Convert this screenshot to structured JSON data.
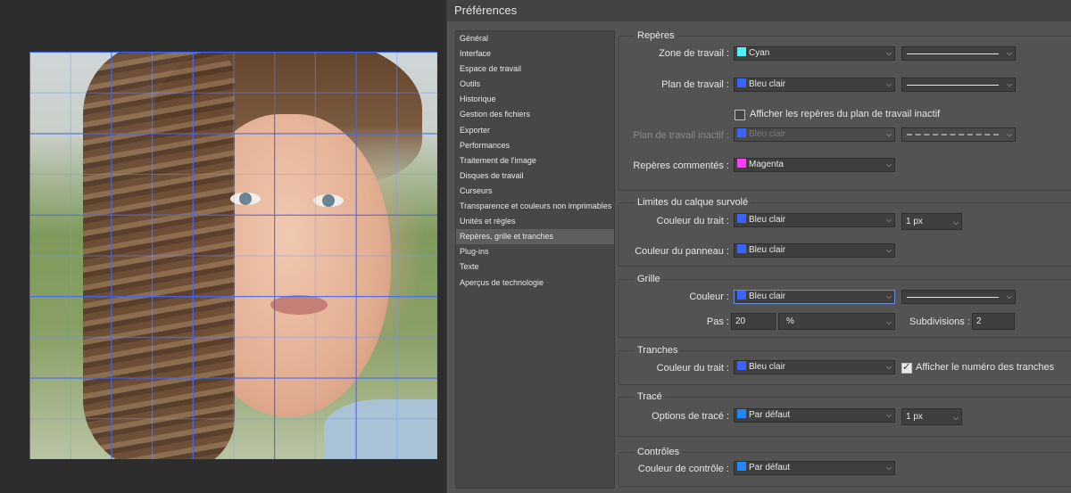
{
  "window": {
    "title": "Préférences"
  },
  "colors": {
    "cyan": "#4df3ff",
    "bleu_clair": "#3a64ff",
    "magenta": "#ff3dff",
    "par_defaut": "#1f86ff"
  },
  "nav": {
    "items": [
      "Général",
      "Interface",
      "Espace de travail",
      "Outils",
      "Historique",
      "Gestion des fichiers",
      "Exporter",
      "Performances",
      "Traitement de l'image",
      "Disques de travail",
      "Curseurs",
      "Transparence et couleurs non imprimables",
      "Unités et règles",
      "Repères, grille et tranches",
      "Plug-ins",
      "Texte",
      "Aperçus de technologie"
    ],
    "selected": "Repères, grille et tranches"
  },
  "reperes": {
    "title": "Repères",
    "zone_label": "Zone de travail :",
    "zone_value": "Cyan",
    "plan_label": "Plan de travail :",
    "plan_value": "Bleu clair",
    "inactive_check_label": "Afficher les repères du plan de travail inactif",
    "inactive_label": "Plan de travail inactif :",
    "inactive_value": "Bleu clair",
    "comment_label": "Repères commentés :",
    "comment_value": "Magenta"
  },
  "limites": {
    "title": "Limites du calque survolé",
    "trait_label": "Couleur du trait :",
    "trait_value": "Bleu clair",
    "trait_width": "1 px",
    "panneau_label": "Couleur du panneau :",
    "panneau_value": "Bleu clair"
  },
  "grille": {
    "title": "Grille",
    "couleur_label": "Couleur :",
    "couleur_value": "Bleu clair",
    "pas_label": "Pas :",
    "pas_value": "20",
    "pas_unit": "%",
    "subdiv_label": "Subdivisions :",
    "subdiv_value": "2"
  },
  "tranches": {
    "title": "Tranches",
    "trait_label": "Couleur du trait :",
    "trait_value": "Bleu clair",
    "numero_label": "Afficher le numéro des tranches"
  },
  "trace": {
    "title": "Tracé",
    "options_label": "Options de tracé :",
    "options_value": "Par défaut",
    "width": "1 px"
  },
  "controles": {
    "title": "Contrôles",
    "couleur_label": "Couleur de contrôle :",
    "couleur_value": "Par défaut"
  }
}
